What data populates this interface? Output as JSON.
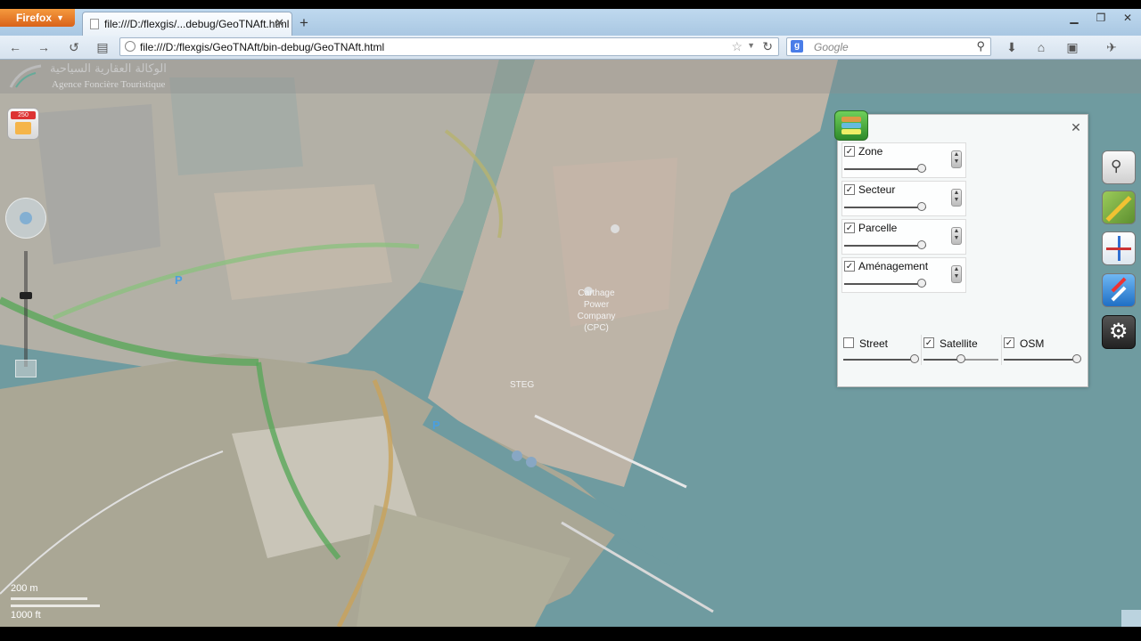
{
  "browser": {
    "menu_button": "Firefox",
    "tab_title": "file:///D:/flexgis/...debug/GeoTNAft.html",
    "url": "file:///D:/flexgis/GeoTNAft/bin-debug/GeoTNAft.html",
    "search_engine": "Google",
    "search_placeholder": "Google"
  },
  "app": {
    "logo_arabic": "الوكالة العقارية السياحية",
    "logo_french": "Agence Foncière Touristique",
    "calendar_badge": "250"
  },
  "map_labels": {
    "company": "Carthage Power Company (CPC)",
    "steg": "STEG",
    "parking": "P"
  },
  "scale": {
    "metric": "200 m",
    "imperial": "1000 ft"
  },
  "layers_panel": {
    "layers": [
      {
        "label": "Zone",
        "checked": true,
        "opacity": 0.95
      },
      {
        "label": "Secteur",
        "checked": true,
        "opacity": 0.95
      },
      {
        "label": "Parcelle",
        "checked": true,
        "opacity": 0.95
      },
      {
        "label": "Aménagement",
        "checked": true,
        "opacity": 0.95
      }
    ],
    "basemaps": [
      {
        "label": "Street",
        "checked": false,
        "opacity": 0.95
      },
      {
        "label": "Satellite",
        "checked": true,
        "opacity": 0.5
      },
      {
        "label": "OSM",
        "checked": true,
        "opacity": 0.95
      }
    ]
  },
  "right_toolbar": [
    "search-icon",
    "route-icon",
    "metro-icon",
    "navigation-icon",
    "settings-icon"
  ],
  "colors": {
    "water": "#6f9ba0",
    "land": "#b9b3a5",
    "green_road": "#5aa75a"
  }
}
